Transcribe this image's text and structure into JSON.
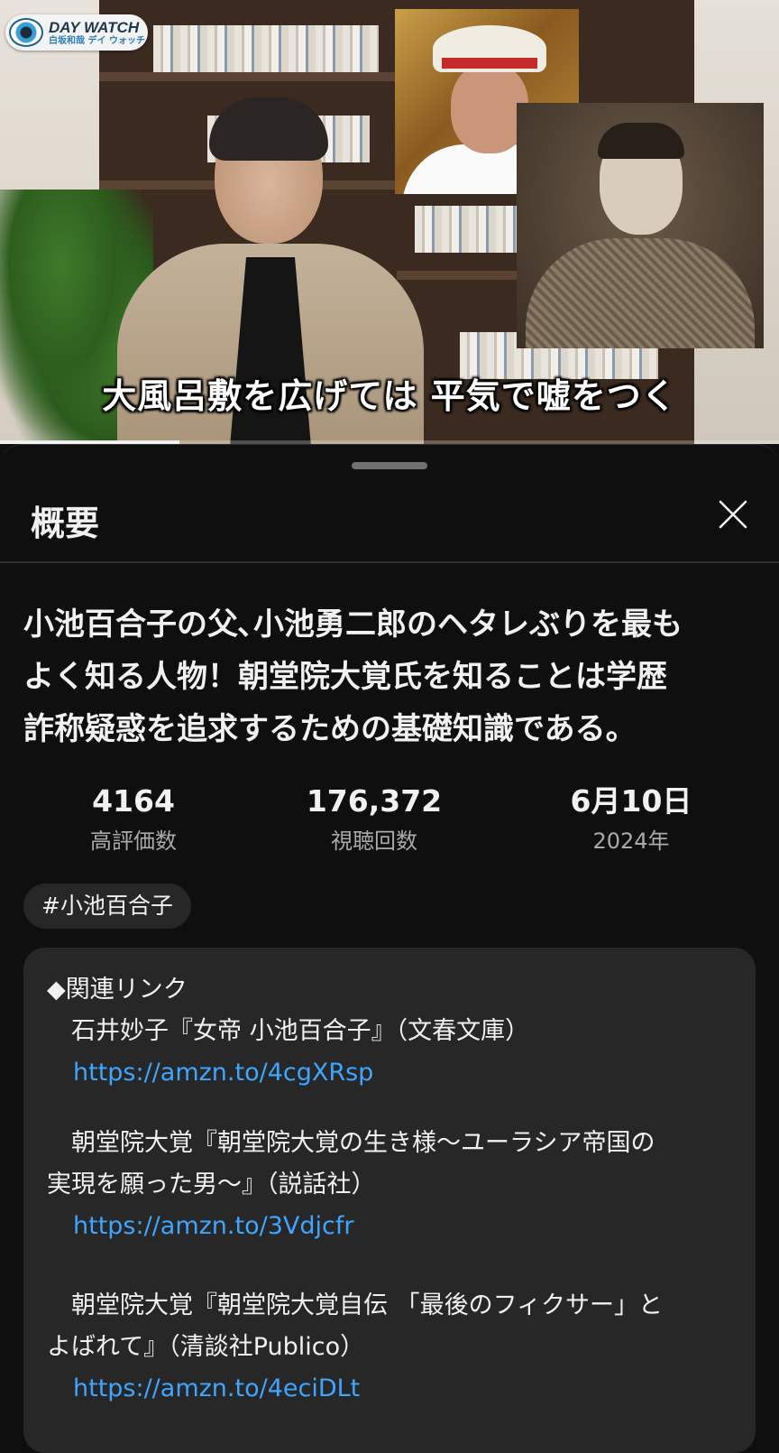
{
  "video": {
    "logo_title": "DAY WATCH",
    "logo_subtitle": "白坂和哉 デイ ウォッチ",
    "caption": "大風呂敷を広げては 平気で嘘をつく",
    "progress_fraction": 0.23
  },
  "sheet": {
    "title": "概要",
    "close_icon": "close-icon",
    "video_title_lines": [
      "小池百合子の父､小池勇二郎のヘタレぶりを最も",
      "よく知る人物！朝堂院大覚氏を知ることは学歴",
      "詐称疑惑を追求するための基礎知識である。"
    ],
    "stats": [
      {
        "value": "4164",
        "label": "高評価数"
      },
      {
        "value": "176,372",
        "label": "視聴回数"
      },
      {
        "value": "6月10日",
        "label": "2024年"
      }
    ],
    "hashtag": "#小池百合子",
    "description": {
      "heading": "◆関連リンク",
      "book1": "　石井妙子『女帝 小池百合子』（文春文庫）",
      "link1": "https://amzn.to/4cgXRsp",
      "book2_line1": "　朝堂院大覚『朝堂院大覚の生き様～ユーラシア帝国の",
      "book2_line2": "実現を願った男～』（説話社）",
      "link2": "https://amzn.to/3Vdjcfr",
      "book3_line1": "　朝堂院大覚『朝堂院大覚自伝 「最後のフィクサー」と",
      "book3_line2": "よばれて』（清談社Publico）",
      "link3": "https://amzn.to/4eciDLt"
    }
  },
  "colors": {
    "background": "#0f0f0f",
    "card": "#272727",
    "link": "#3ea6ff",
    "secondary_text": "#aaaaaa"
  }
}
